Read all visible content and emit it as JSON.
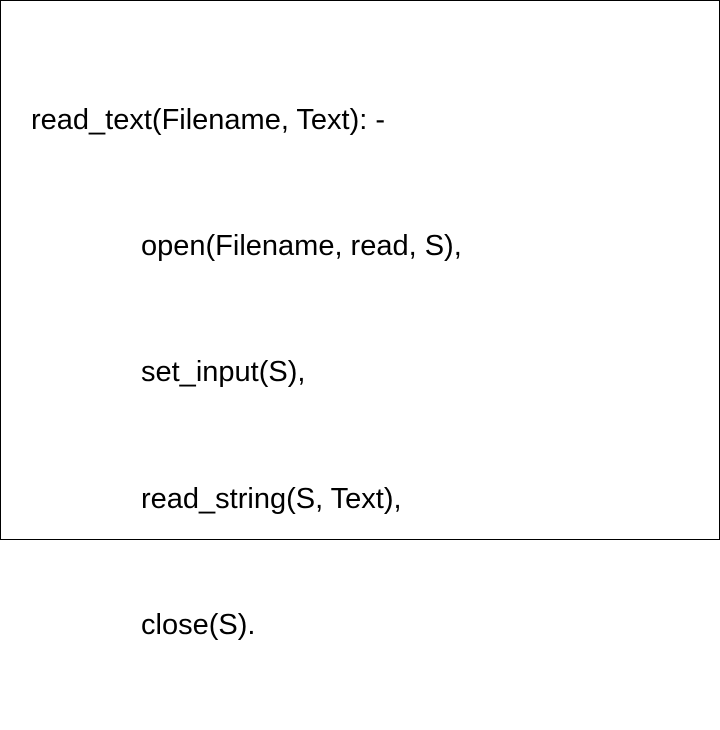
{
  "code": {
    "line1": "read_text(Filename, Text): -",
    "line2": "open(Filename, read, S),",
    "line3": "set_input(S),",
    "line4": "read_string(S, Text),",
    "line5": "close(S)."
  }
}
